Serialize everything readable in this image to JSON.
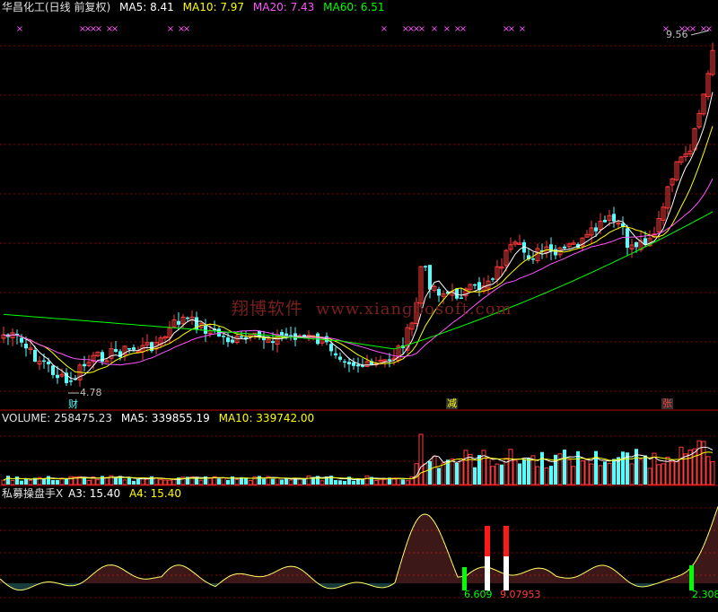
{
  "main": {
    "title": "华昌化工(日线 前复权)",
    "ma5_label": "MA5: 8.41",
    "ma10_label": "MA10: 7.97",
    "ma20_label": "MA20: 7.43",
    "ma60_label": "MA60: 6.51",
    "high_label": "9.56",
    "low_label": "4.78",
    "marker_cai": "财",
    "marker_jian": "减",
    "marker_zhang": "张",
    "watermark_cn": "翔博软件",
    "watermark_url": "www.xiangbosoft.com"
  },
  "volume": {
    "label": "VOLUME: 258475.23",
    "ma5_label": "MA5: 339855.19",
    "ma10_label": "MA10: 339742.00"
  },
  "indicator": {
    "title": "私募操盘手X",
    "a3_label": "A3: 15.40",
    "a4_label": "A4: 15.40",
    "value_1": "6.609",
    "value_2": "9.07953",
    "value_3": "2.308"
  },
  "colors": {
    "up": "#ff3b3b",
    "down": "#54ffff",
    "ma5": "#ffffff",
    "ma10": "#ffff00",
    "ma20": "#ff55ff",
    "ma60": "#00ff00",
    "grid": "#8b0000",
    "marker": "#ff55ff"
  }
}
